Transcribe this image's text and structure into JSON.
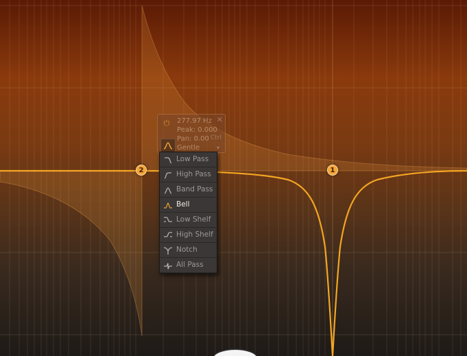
{
  "band_panel": {
    "frequency": "277.97 Hz",
    "gain": "Peak: 0.000",
    "pan": "Pan: 0.00",
    "ctrl_label": "Ctrl",
    "slope": "Gentle",
    "close_glyph": "✕",
    "power_icon": "power-icon",
    "arrow_glyph": "▾"
  },
  "nodes": [
    {
      "label": "2"
    },
    {
      "label": "1"
    }
  ],
  "shape_menu": {
    "items": [
      {
        "label": "Low Pass",
        "icon": "low-pass-icon",
        "selected": false
      },
      {
        "label": "High Pass",
        "icon": "high-pass-icon",
        "selected": false
      },
      {
        "label": "Band Pass",
        "icon": "band-pass-icon",
        "selected": false
      },
      {
        "label": "Bell",
        "icon": "bell-icon",
        "selected": true
      },
      {
        "label": "Low Shelf",
        "icon": "low-shelf-icon",
        "selected": false
      },
      {
        "label": "High Shelf",
        "icon": "high-shelf-icon",
        "selected": false
      },
      {
        "label": "Notch",
        "icon": "notch-icon",
        "selected": false
      },
      {
        "label": "All Pass",
        "icon": "all-pass-icon",
        "selected": false
      }
    ]
  },
  "colors": {
    "curve": "#f5a623",
    "accent": "#e9a23b",
    "menu_bg": "#3a3736",
    "menu_text": "#9b9896",
    "menu_selected_text": "#f2efe9"
  }
}
